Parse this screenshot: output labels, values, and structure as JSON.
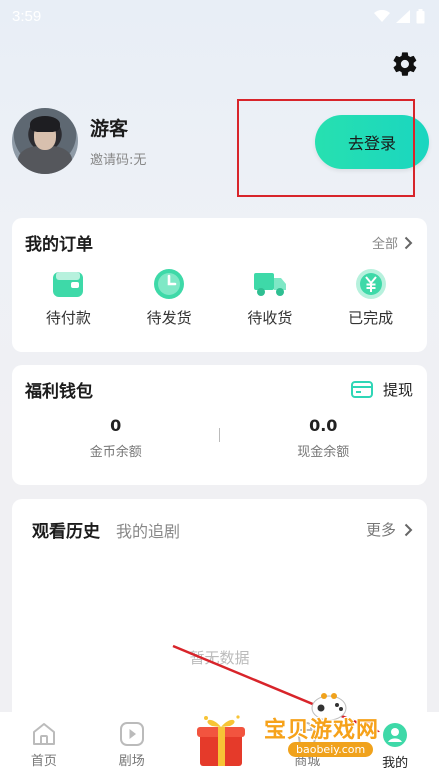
{
  "status_bar": {
    "time": "3:59"
  },
  "profile": {
    "name": "游客",
    "invite_code": "邀请码:无"
  },
  "login_button": {
    "label": "去登录"
  },
  "orders": {
    "title": "我的订单",
    "all_label": "全部",
    "items": [
      {
        "label": "待付款",
        "icon": "wallet-icon",
        "color": "#3ed9a8"
      },
      {
        "label": "待发货",
        "icon": "clock-icon",
        "color": "#3ed9a8"
      },
      {
        "label": "待收货",
        "icon": "truck-icon",
        "color": "#3ed9a8"
      },
      {
        "label": "已完成",
        "icon": "yen-coin-icon",
        "color": "#3ed9a8"
      }
    ]
  },
  "wallet": {
    "title": "福利钱包",
    "withdraw_label": "提现",
    "coins": {
      "value": "0",
      "label": "金币余额"
    },
    "cash": {
      "value": "0.0",
      "label": "现金余额"
    }
  },
  "history": {
    "title": "观看历史",
    "tab2": "我的追剧",
    "more_label": "更多",
    "empty_text": "暂无数据"
  },
  "tabbar": {
    "items": [
      {
        "label": "首页",
        "icon": "home-icon"
      },
      {
        "label": "剧场",
        "icon": "play-icon"
      },
      {
        "label": "",
        "icon": "gift-box-icon"
      },
      {
        "label": "商城",
        "icon": "shop-icon"
      },
      {
        "label": "我的",
        "icon": "profile-icon"
      }
    ]
  },
  "watermark": {
    "title": "宝贝游戏网",
    "url": "baobeiy.com"
  },
  "colors": {
    "accent": "#1fddb8",
    "annotation_red": "#d8242a"
  }
}
